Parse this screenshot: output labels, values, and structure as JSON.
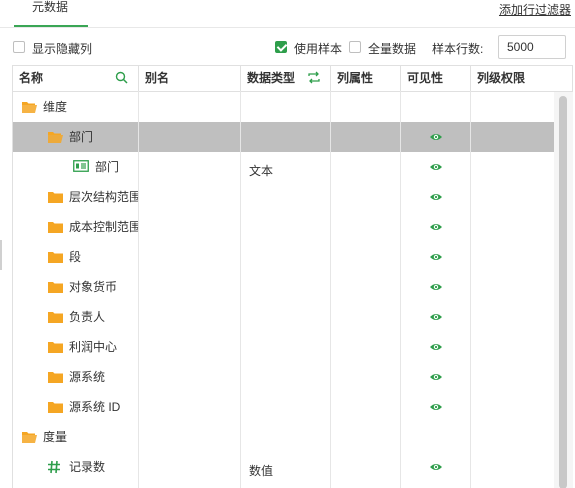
{
  "tabs": [
    {
      "label": "元数据"
    }
  ],
  "add_filter_label": "添加行过滤器",
  "toolbar": {
    "show_hidden_label": "显示隐藏列",
    "show_hidden_checked": false,
    "use_sample_label": "使用样本",
    "use_sample_checked": true,
    "full_data_label": "全量数据",
    "full_data_checked": false,
    "sample_rows_label": "样本行数:",
    "sample_rows_value": "5000"
  },
  "columns": [
    {
      "label": "名称",
      "icon": "search-icon"
    },
    {
      "label": "别名"
    },
    {
      "label": "数据类型",
      "icon": "swap-icon"
    },
    {
      "label": "列属性"
    },
    {
      "label": "可见性"
    },
    {
      "label": "列级权限"
    }
  ],
  "rows": [
    {
      "name": "维度",
      "icon": "folder-open-icon",
      "level": 0,
      "type": "",
      "visible": false,
      "selected": false
    },
    {
      "name": "部门",
      "icon": "folder-open-icon",
      "level": 1,
      "type": "",
      "visible": true,
      "selected": true
    },
    {
      "name": "部门",
      "icon": "dimension-field-icon",
      "level": 2,
      "type": "文本",
      "visible": true,
      "selected": false
    },
    {
      "name": "层次结构范围",
      "icon": "folder-icon",
      "level": 1,
      "type": "",
      "visible": true,
      "selected": false
    },
    {
      "name": "成本控制范围",
      "icon": "folder-icon",
      "level": 1,
      "type": "",
      "visible": true,
      "selected": false
    },
    {
      "name": "段",
      "icon": "folder-icon",
      "level": 1,
      "type": "",
      "visible": true,
      "selected": false
    },
    {
      "name": "对象货币",
      "icon": "folder-icon",
      "level": 1,
      "type": "",
      "visible": true,
      "selected": false
    },
    {
      "name": "负责人",
      "icon": "folder-icon",
      "level": 1,
      "type": "",
      "visible": true,
      "selected": false
    },
    {
      "name": "利润中心",
      "icon": "folder-icon",
      "level": 1,
      "type": "",
      "visible": true,
      "selected": false
    },
    {
      "name": "源系统",
      "icon": "folder-icon",
      "level": 1,
      "type": "",
      "visible": true,
      "selected": false
    },
    {
      "name": "源系统 ID",
      "icon": "folder-icon",
      "level": 1,
      "type": "",
      "visible": true,
      "selected": false
    },
    {
      "name": "度量",
      "icon": "folder-open-icon",
      "level": 0,
      "type": "",
      "visible": false,
      "selected": false
    },
    {
      "name": "记录数",
      "icon": "hash-icon",
      "level": 1,
      "type": "数值",
      "visible": true,
      "selected": false
    }
  ],
  "colors": {
    "accent": "#2e9e4b",
    "folder": "#f5a623",
    "selected_row": "#bfbfbf"
  }
}
